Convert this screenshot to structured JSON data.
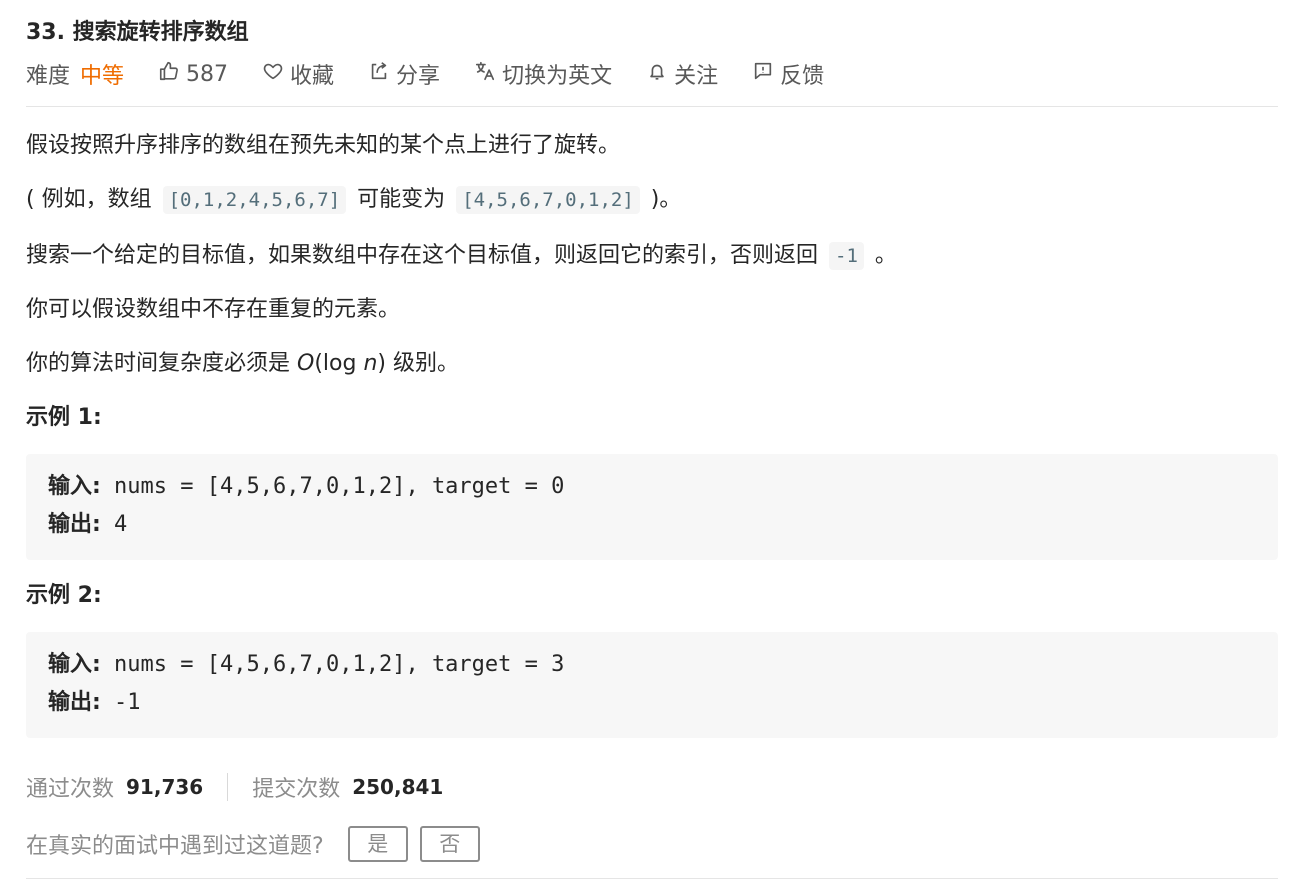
{
  "problem": {
    "title": "33. 搜索旋转排序数组"
  },
  "toolbar": {
    "difficulty_label": "难度",
    "difficulty_value": "中等",
    "likes": "587",
    "favorite_label": "收藏",
    "share_label": "分享",
    "translate_label": "切换为英文",
    "follow_label": "关注",
    "feedback_label": "反馈"
  },
  "description": {
    "p1": "假设按照升序排序的数组在预先未知的某个点上进行了旋转。",
    "p2_prefix": "( 例如，数组",
    "p2_code1": "[0,1,2,4,5,6,7]",
    "p2_middle": "可能变为",
    "p2_code2": "[4,5,6,7,0,1,2]",
    "p2_suffix": ")。",
    "p3_prefix": "搜索一个给定的目标值，如果数组中存在这个目标值，则返回它的索引，否则返回",
    "p3_code": "-1",
    "p3_suffix": "。",
    "p4": "你可以假设数组中不存在重复的元素。",
    "p5_prefix": "你的算法时间复杂度必须是",
    "p5_O": "O",
    "p5_mid": "(log",
    "p5_n": "n",
    "p5_suffix": ") 级别。"
  },
  "examples": [
    {
      "heading": "示例 1:",
      "input_label": "输入:",
      "input_value": " nums = [4,5,6,7,0,1,2], target = 0",
      "output_label": "输出:",
      "output_value": " 4"
    },
    {
      "heading": "示例 2:",
      "input_label": "输入:",
      "input_value": " nums = [4,5,6,7,0,1,2], target = 3",
      "output_label": "输出:",
      "output_value": " -1"
    }
  ],
  "stats": {
    "accepted_label": "通过次数",
    "accepted_value": "91,736",
    "submissions_label": "提交次数",
    "submissions_value": "250,841"
  },
  "survey": {
    "question": "在真实的面试中遇到过这道题?",
    "yes_label": "是",
    "no_label": "否"
  },
  "colors": {
    "difficulty_medium": "#ef6c00",
    "text": "#262626",
    "muted": "#8c8c8c",
    "code_bg": "#f7f7f7"
  }
}
